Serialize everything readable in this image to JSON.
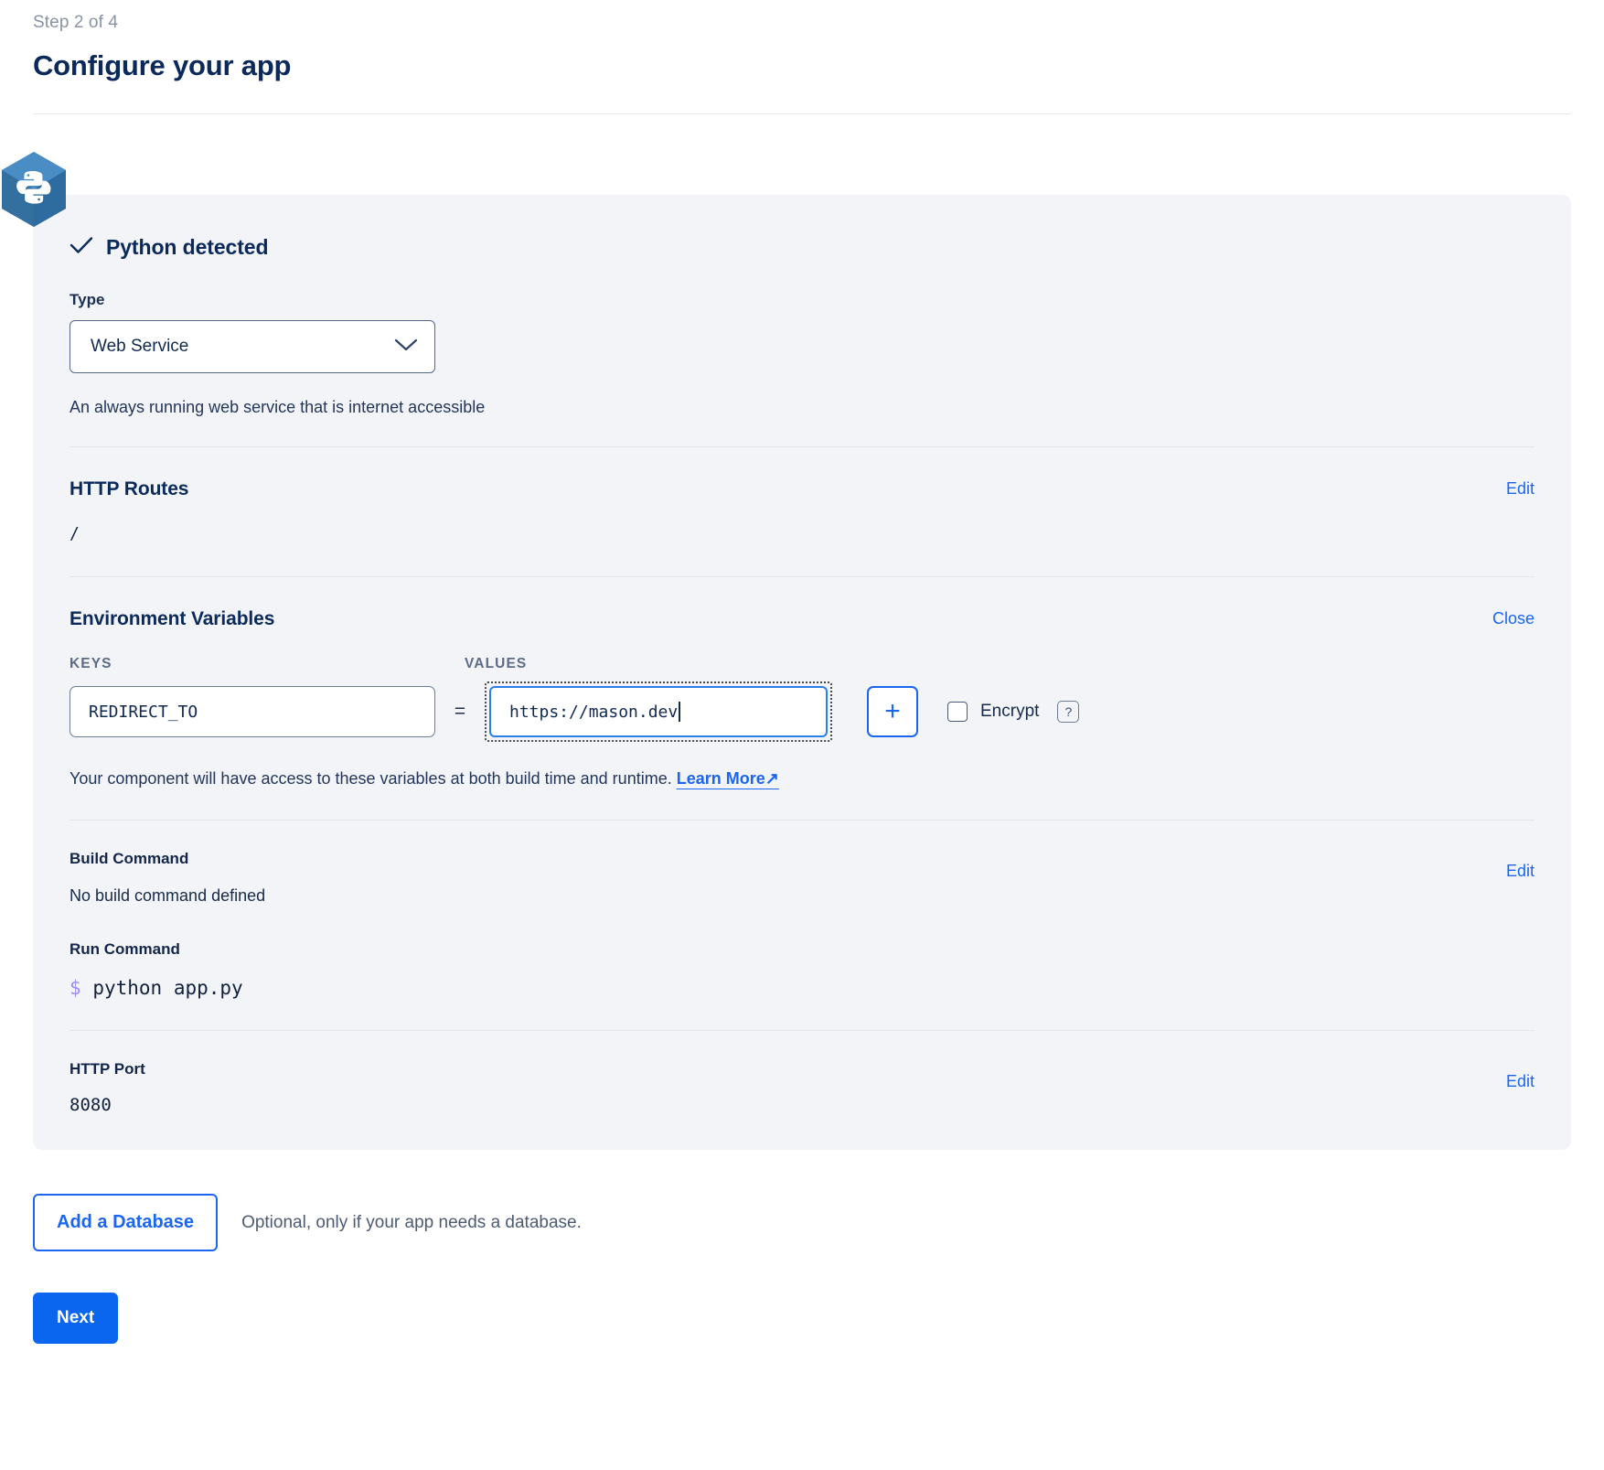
{
  "header": {
    "step": "Step 2 of 4",
    "title": "Configure your app"
  },
  "card": {
    "detected": {
      "label": "Python detected",
      "icon": "check-icon",
      "badge_icon": "python-logo-icon"
    },
    "type_field": {
      "label": "Type",
      "value": "Web Service",
      "chevron": "chevron-down-icon",
      "description": "An always running web service that is internet accessible"
    },
    "http_routes": {
      "title": "HTTP Routes",
      "action": "Edit",
      "value": "/"
    },
    "env_vars": {
      "title": "Environment Variables",
      "action": "Close",
      "col_keys": "KEYS",
      "col_values": "VALUES",
      "key": "REDIRECT_TO",
      "equals": "=",
      "value": "https://mason.dev",
      "add_label": "+",
      "encrypt_label": "Encrypt",
      "help_label": "?",
      "helper_text": "Your component will have access to these variables at both build time and runtime.",
      "learn_more": "Learn More",
      "learn_more_arrow": "↗"
    },
    "build_command": {
      "label": "Build Command",
      "value": "No build command defined",
      "action": "Edit"
    },
    "run_command": {
      "label": "Run Command",
      "prompt": "$",
      "value": "python app.py"
    },
    "http_port": {
      "label": "HTTP Port",
      "value": "8080",
      "action": "Edit"
    }
  },
  "footer": {
    "add_database": "Add a Database",
    "database_note": "Optional, only if your app needs a database.",
    "next": "Next"
  },
  "colors": {
    "accent_blue": "#1a66f0",
    "primary_button": "#0a66ef",
    "card_bg": "#f2f4f8",
    "title_navy": "#0b2a5b",
    "muted": "#8a93a5",
    "prompt_purple": "#9d8ef0",
    "python_blue": "#3577b1"
  }
}
